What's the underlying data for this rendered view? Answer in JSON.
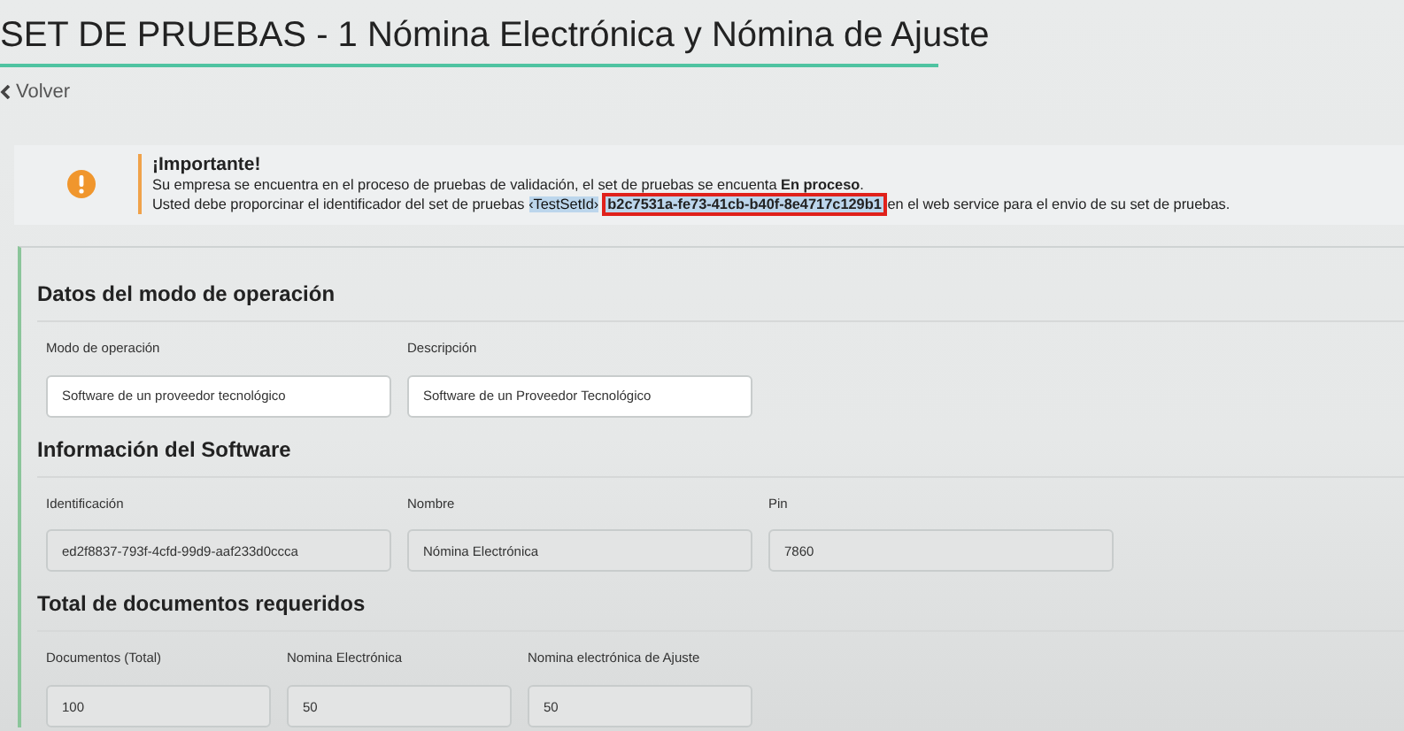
{
  "page": {
    "title": "SET DE PRUEBAS - 1 Nómina Electrónica y Nómina de Ajuste",
    "back_link": "Volver"
  },
  "alert": {
    "title": "¡Importante!",
    "line_1": "Su empresa se encuentra en el proceso de pruebas de validación, el set de pruebas se encuenta **En proceso**.",
    "line_2_before": "Usted debe proporcinar el identificador del set de pruebas",
    "token": "‹TestSetId›",
    "token_selected": true,
    "test_set_id": "b2c7531a-fe73-41cb-b40f-8e4717c129b1",
    "test_set_id_boxed": true,
    "line_2_after": "en el web service para el envio de su set de pruebas."
  },
  "sections": [
    {
      "heading": "Datos del modo de operación",
      "fields": [
        {
          "label": "Modo de operación",
          "value": "Software de un proveedor tecnológico",
          "disabled": false
        },
        {
          "label": "Descripción",
          "value": "Software de un Proveedor Tecnológico",
          "disabled": false
        }
      ]
    },
    {
      "heading": "Información del Software",
      "fields": [
        {
          "label": "Identificación",
          "value": "ed2f8837-793f-4cfd-99d9-aaf233d0ccca",
          "disabled": true
        },
        {
          "label": "Nombre",
          "value": "Nómina Electrónica",
          "disabled": true
        },
        {
          "label": "Pin",
          "value": "7860",
          "disabled": true
        }
      ]
    },
    {
      "heading": "Total de documentos requeridos",
      "kind": "counts",
      "fields": [
        {
          "label": "Documentos (Total)",
          "value": "100",
          "disabled": true
        },
        {
          "label": "Nomina Electrónica",
          "value": "50",
          "disabled": true
        },
        {
          "label": "Nomina electrónica de Ajuste",
          "value": "50",
          "disabled": true
        }
      ]
    }
  ]
}
